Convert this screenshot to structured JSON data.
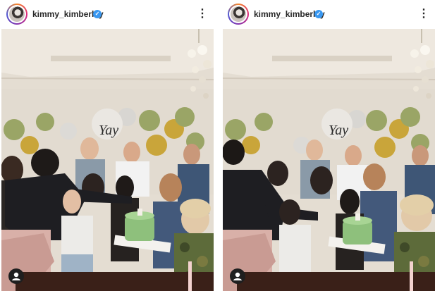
{
  "posts": [
    {
      "username": "kimmy_kimberley",
      "verified": true,
      "verified_glyph": "✓",
      "more_glyph": "⋮",
      "balloon_text": "Yay",
      "icons": {
        "avatar": "profile-avatar",
        "verified": "verified-badge-icon",
        "more": "more-options-icon",
        "user_tag": "user-tag-icon"
      }
    },
    {
      "username": "kimmy_kimberley",
      "verified": true,
      "verified_glyph": "✓",
      "more_glyph": "⋮",
      "balloon_text": "Yay",
      "icons": {
        "avatar": "profile-avatar",
        "verified": "verified-badge-icon",
        "more": "more-options-icon",
        "user_tag": "user-tag-icon"
      }
    }
  ],
  "colors": {
    "verified_blue": "#3897f0",
    "username_text": "#262626",
    "balloon_gold": "#c9a53a",
    "balloon_sage": "#9aa566",
    "wall": "#e8e2d8",
    "cake_green": "#8ec07c"
  }
}
